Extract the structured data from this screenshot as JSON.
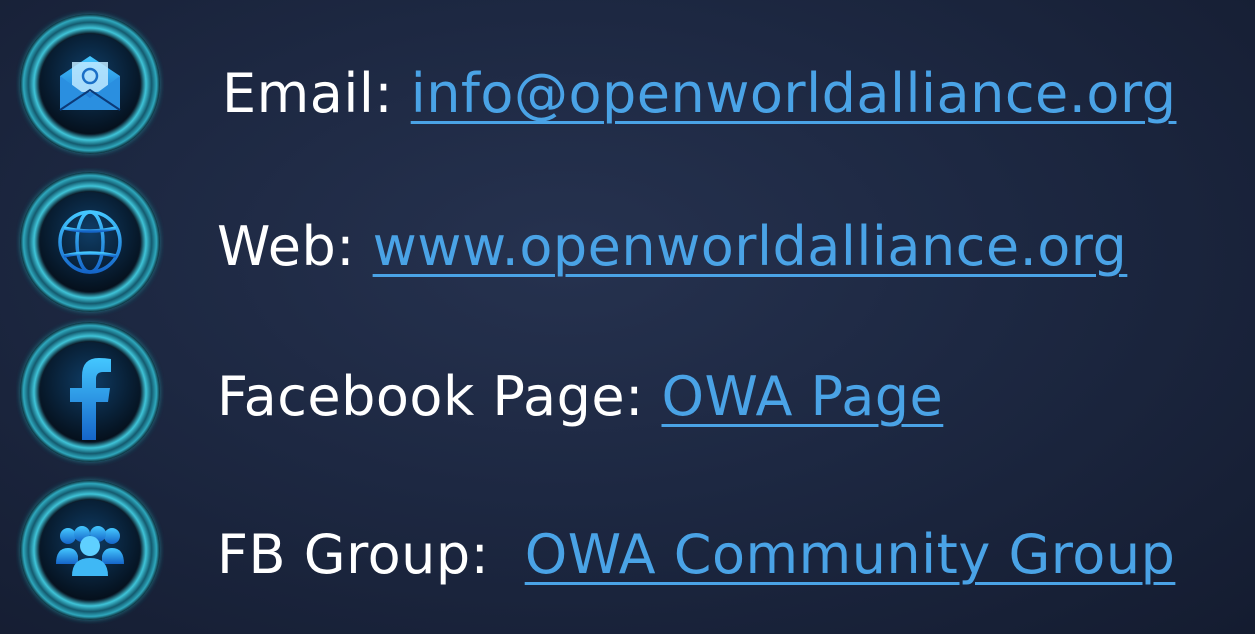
{
  "contacts": {
    "email": {
      "label": "Email:",
      "link": "info@openworldalliance.org",
      "icon": "email-icon"
    },
    "web": {
      "label": "Web:",
      "link": "www.openworldalliance.org",
      "icon": "globe-icon"
    },
    "facebook": {
      "label": "Facebook Page:",
      "link": "OWA Page",
      "icon": "facebook-icon"
    },
    "group": {
      "label": "FB Group: ",
      "link": "OWA Community Group",
      "icon": "group-icon"
    }
  },
  "colors": {
    "background": "#1d2842",
    "link": "#4aa3e6",
    "text": "#ffffff",
    "icon_ring": "#2fb0c9",
    "icon_fill": "#1e6fd0"
  }
}
